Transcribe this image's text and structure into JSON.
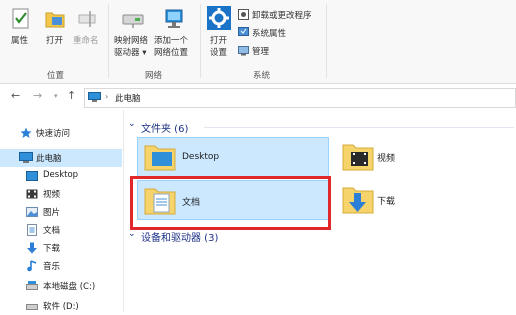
{
  "ribbon": {
    "open_group": {
      "properties": "属性",
      "open": "打开",
      "rename": "重命名",
      "label": "位置"
    },
    "network_group": {
      "map_drive_line1": "映射网络",
      "map_drive_line2": "驱动器 ▾",
      "add_location_line1": "添加一个",
      "add_location_line2": "网络位置",
      "label": "网络"
    },
    "system_group": {
      "open_settings_line1": "打开",
      "open_settings_line2": "设置",
      "uninstall": "卸载或更改程序",
      "system_properties": "系统属性",
      "manage": "管理",
      "label": "系统"
    }
  },
  "address": {
    "path": "此电脑"
  },
  "nav": {
    "quick_access": "快速访问",
    "this_pc": "此电脑",
    "items": [
      "Desktop",
      "视频",
      "图片",
      "文档",
      "下载",
      "音乐",
      "本地磁盘 (C:)",
      "软件 (D:)"
    ]
  },
  "content": {
    "folders_header": "文件夹 (6)",
    "devices_header": "设备和驱动器 (3)",
    "folders": {
      "desktop": "Desktop",
      "videos": "视频",
      "documents": "文档",
      "downloads": "下载"
    }
  },
  "colors": {
    "selection": "#cce8ff",
    "highlight_box": "#e0282b",
    "section_header": "#1e3287"
  }
}
